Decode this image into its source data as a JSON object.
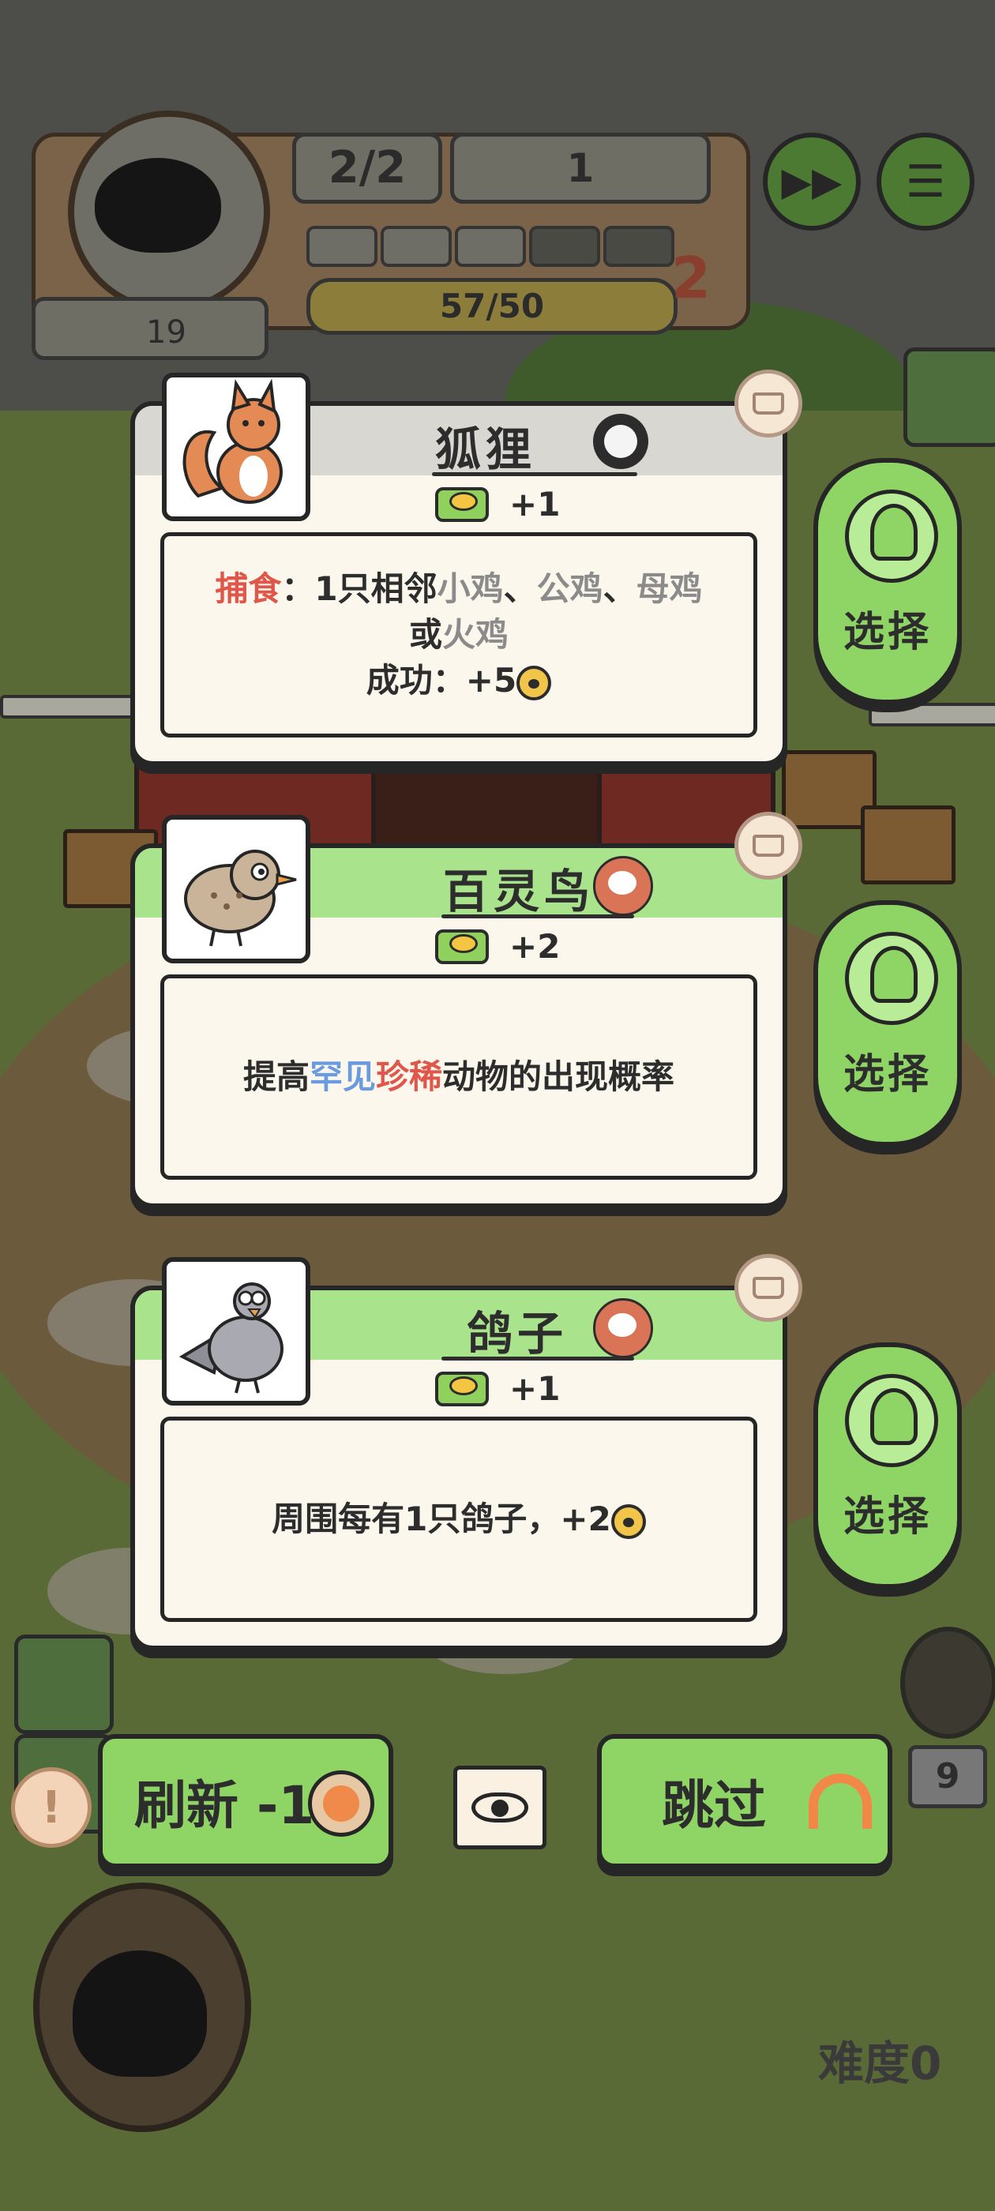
{
  "hud": {
    "wave": "2/2",
    "cans": "1",
    "progress": "57/50",
    "level": "19",
    "round": "2",
    "segments_filled": 3,
    "segments_total": 5
  },
  "cards": [
    {
      "name": "狐狸",
      "type": "predator",
      "food_gain": "+1",
      "desc": {
        "lead": "捕食",
        "sep": "：",
        "count": "1只相邻",
        "t1": "小鸡",
        "c1": "、",
        "t2": "公鸡",
        "c2": "、",
        "t3": "母鸡",
        "or": "或",
        "t4": "火鸡",
        "success": "成功：+5"
      },
      "select_label": "选择"
    },
    {
      "name": "百灵鸟",
      "type": "bird",
      "food_gain": "+2",
      "desc": {
        "pre": "提高",
        "rare": "罕见",
        "precious": "珍稀",
        "post": "动物的出现概率"
      },
      "select_label": "选择"
    },
    {
      "name": "鸽子",
      "type": "bird",
      "food_gain": "+1",
      "desc": {
        "text": "周围每有1只鸽子，+2"
      },
      "select_label": "选择"
    }
  ],
  "buttons": {
    "refresh": "刷新 -1",
    "skip": "跳过",
    "alert": "!"
  },
  "counter_right": "9",
  "difficulty": "难度0",
  "colors": {
    "card_bg": "#fbf7ec",
    "green_head": "#a9e38b",
    "gray_head": "#d9d7d1",
    "button_green": "#8fd565",
    "red_text": "#e0564a",
    "blue_text": "#6a9ae0"
  }
}
